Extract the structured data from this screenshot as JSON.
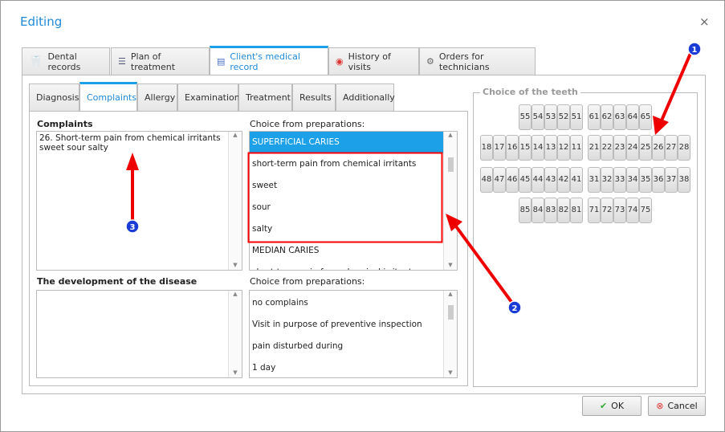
{
  "title": "Editing",
  "close": "×",
  "tabs": [
    {
      "label": "Dental records",
      "icon": "tooth-icon"
    },
    {
      "label": "Plan of treatment",
      "icon": "list-icon"
    },
    {
      "label": "Client's medical record",
      "icon": "document-icon"
    },
    {
      "label": "History of visits",
      "icon": "history-icon"
    },
    {
      "label": "Orders for technicians",
      "icon": "gears-icon"
    }
  ],
  "subtabs": [
    "Diagnosis",
    "Complaints",
    "Allergy",
    "Examination",
    "Treatment",
    "Results",
    "Additionally"
  ],
  "complaints": {
    "label": "Complaints",
    "value": "26. Short-term pain from chemical irritants sweet sour salty",
    "prep_label": "Choice from preparations:",
    "items": [
      "SUPERFICIAL CARIES",
      "short-term pain from chemical irritants",
      "sweet",
      "sour",
      "salty",
      "MEDIAN CARIES",
      "short-term pain from chemical irritants"
    ]
  },
  "development": {
    "label": "The development of the disease",
    "value": "",
    "prep_label": "Choice from preparations:",
    "items": [
      "no complains",
      "Visit in purpose of preventive inspection",
      "pain disturbed during",
      "1 day"
    ]
  },
  "teeth": {
    "title": "Choice of the teeth",
    "rows": [
      [
        [
          "55",
          "54",
          "53",
          "52",
          "51"
        ],
        [
          "61",
          "62",
          "63",
          "64",
          "65"
        ]
      ],
      [
        [
          "18",
          "17",
          "16",
          "15",
          "14",
          "13",
          "12",
          "11"
        ],
        [
          "21",
          "22",
          "23",
          "24",
          "25",
          "26",
          "27",
          "28"
        ]
      ],
      [
        [
          "48",
          "47",
          "46",
          "45",
          "44",
          "43",
          "42",
          "41"
        ],
        [
          "31",
          "32",
          "33",
          "34",
          "35",
          "36",
          "37",
          "38"
        ]
      ],
      [
        [
          "85",
          "84",
          "83",
          "82",
          "81"
        ],
        [
          "71",
          "72",
          "73",
          "74",
          "75"
        ]
      ]
    ]
  },
  "buttons": {
    "ok": "OK",
    "cancel": "Cancel"
  },
  "callouts": [
    "1",
    "2",
    "3"
  ],
  "colors": {
    "accent": "#1ca0e8",
    "annotation": "#ff0000",
    "badge": "#1a3bd6"
  }
}
